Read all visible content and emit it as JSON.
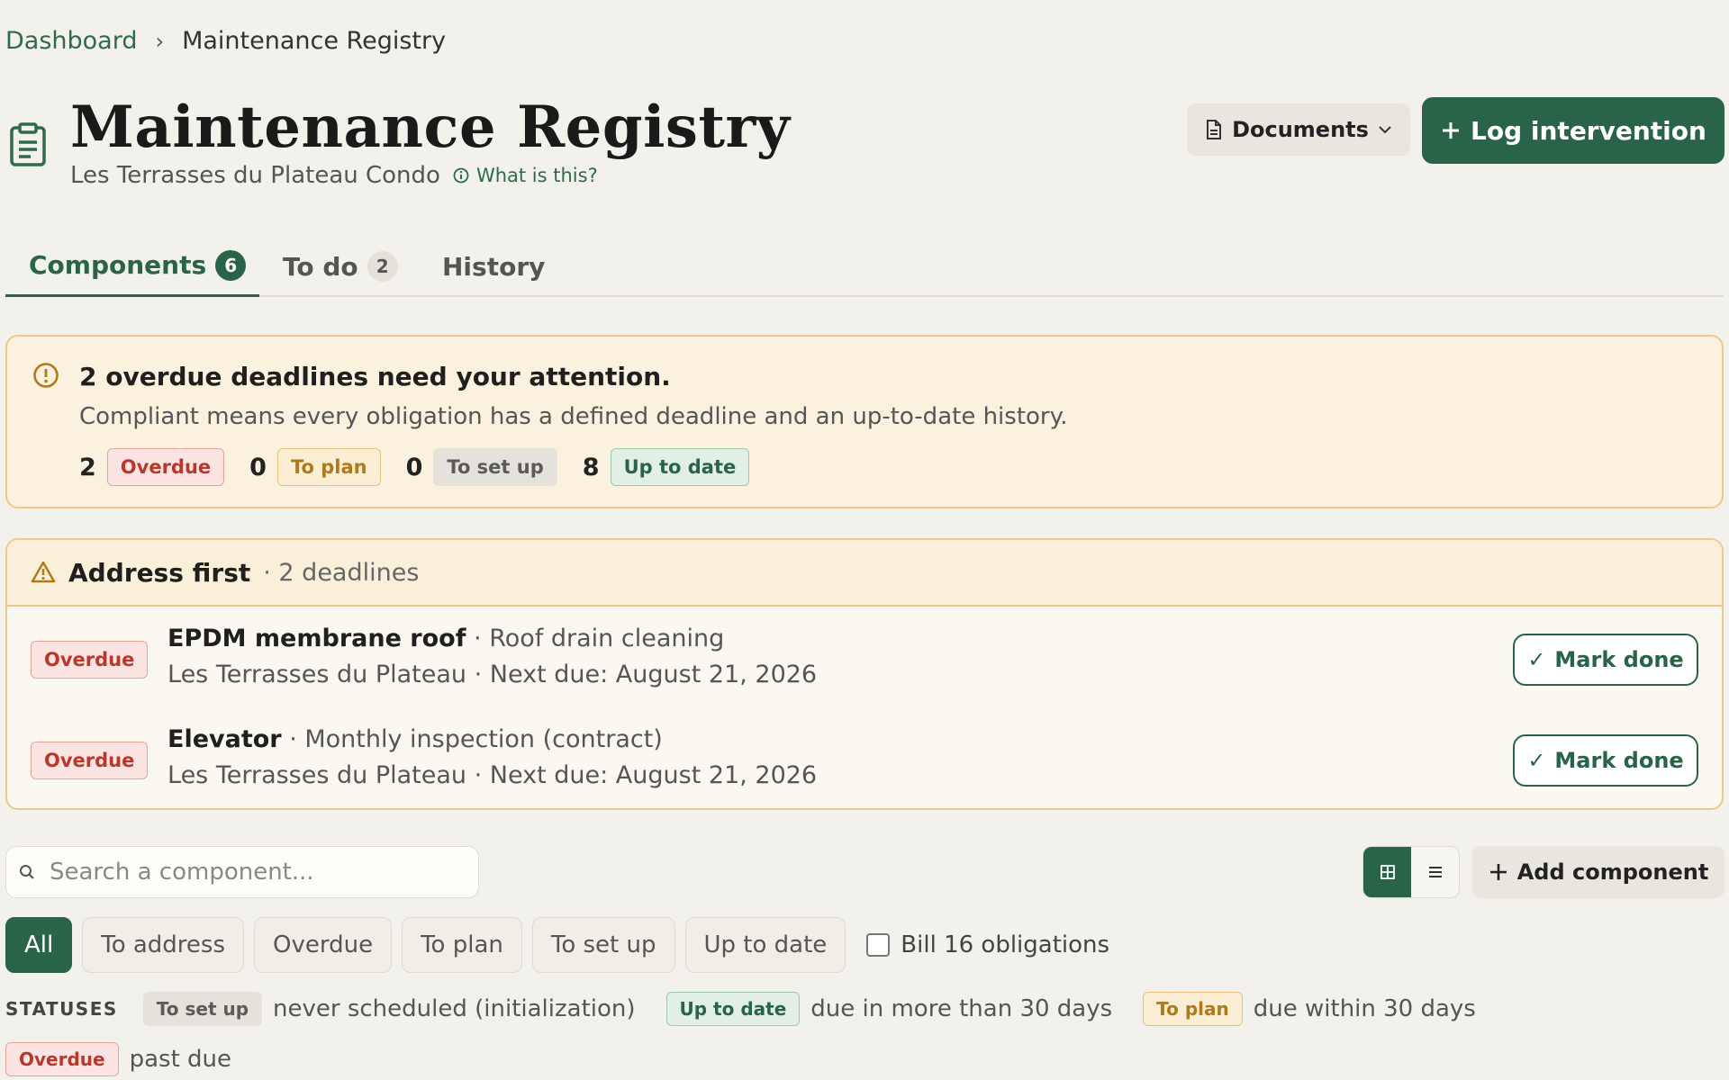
{
  "breadcrumb": {
    "root": "Dashboard",
    "current": "Maintenance Registry"
  },
  "header": {
    "title": "Maintenance Registry",
    "subtitle": "Les Terrasses du Plateau Condo",
    "help_link": "What is this?",
    "documents_label": "Documents",
    "log_label": "Log intervention",
    "icon": "clipboard-icon"
  },
  "tabs": [
    {
      "label": "Components",
      "count": "6",
      "active": true
    },
    {
      "label": "To do",
      "count": "2",
      "active": false
    },
    {
      "label": "History",
      "count": "",
      "active": false
    }
  ],
  "attention": {
    "title": "2 overdue deadlines need your attention.",
    "description": "Compliant means every obligation has a defined deadline and an up-to-date history.",
    "stats": [
      {
        "count": "2",
        "label": "Overdue"
      },
      {
        "count": "0",
        "label": "To plan"
      },
      {
        "count": "0",
        "label": "To set up"
      },
      {
        "count": "8",
        "label": "Up to date"
      }
    ]
  },
  "address_first": {
    "title": "Address first",
    "count_text": "· 2 deadlines",
    "items": [
      {
        "status": "Overdue",
        "component": "EPDM membrane roof",
        "task": " · Roof drain cleaning",
        "details": "Les Terrasses du Plateau · Next due: August 21, 2026",
        "action": "Mark done"
      },
      {
        "status": "Overdue",
        "component": "Elevator",
        "task": " · Monthly inspection (contract)",
        "details": "Les Terrasses du Plateau · Next due: August 21, 2026",
        "action": "Mark done"
      }
    ]
  },
  "toolbar": {
    "search_placeholder": "Search a component...",
    "add_label": "Add component"
  },
  "filters": [
    "All",
    "To address",
    "Overdue",
    "To plan",
    "To set up",
    "Up to date"
  ],
  "bill_label": "Bill 16 obligations",
  "legend": {
    "title": "STATUSES",
    "items": [
      {
        "label": "To set up",
        "text": "never scheduled (initialization)"
      },
      {
        "label": "Up to date",
        "text": "due in more than 30 days"
      },
      {
        "label": "To plan",
        "text": "due within 30 days"
      },
      {
        "label": "Overdue",
        "text": "past due"
      }
    ]
  },
  "colors": {
    "accent": "#2a6448",
    "overdue": "#b8382c",
    "to_plan": "#b07a18",
    "warning_bg": "#faf1df"
  }
}
